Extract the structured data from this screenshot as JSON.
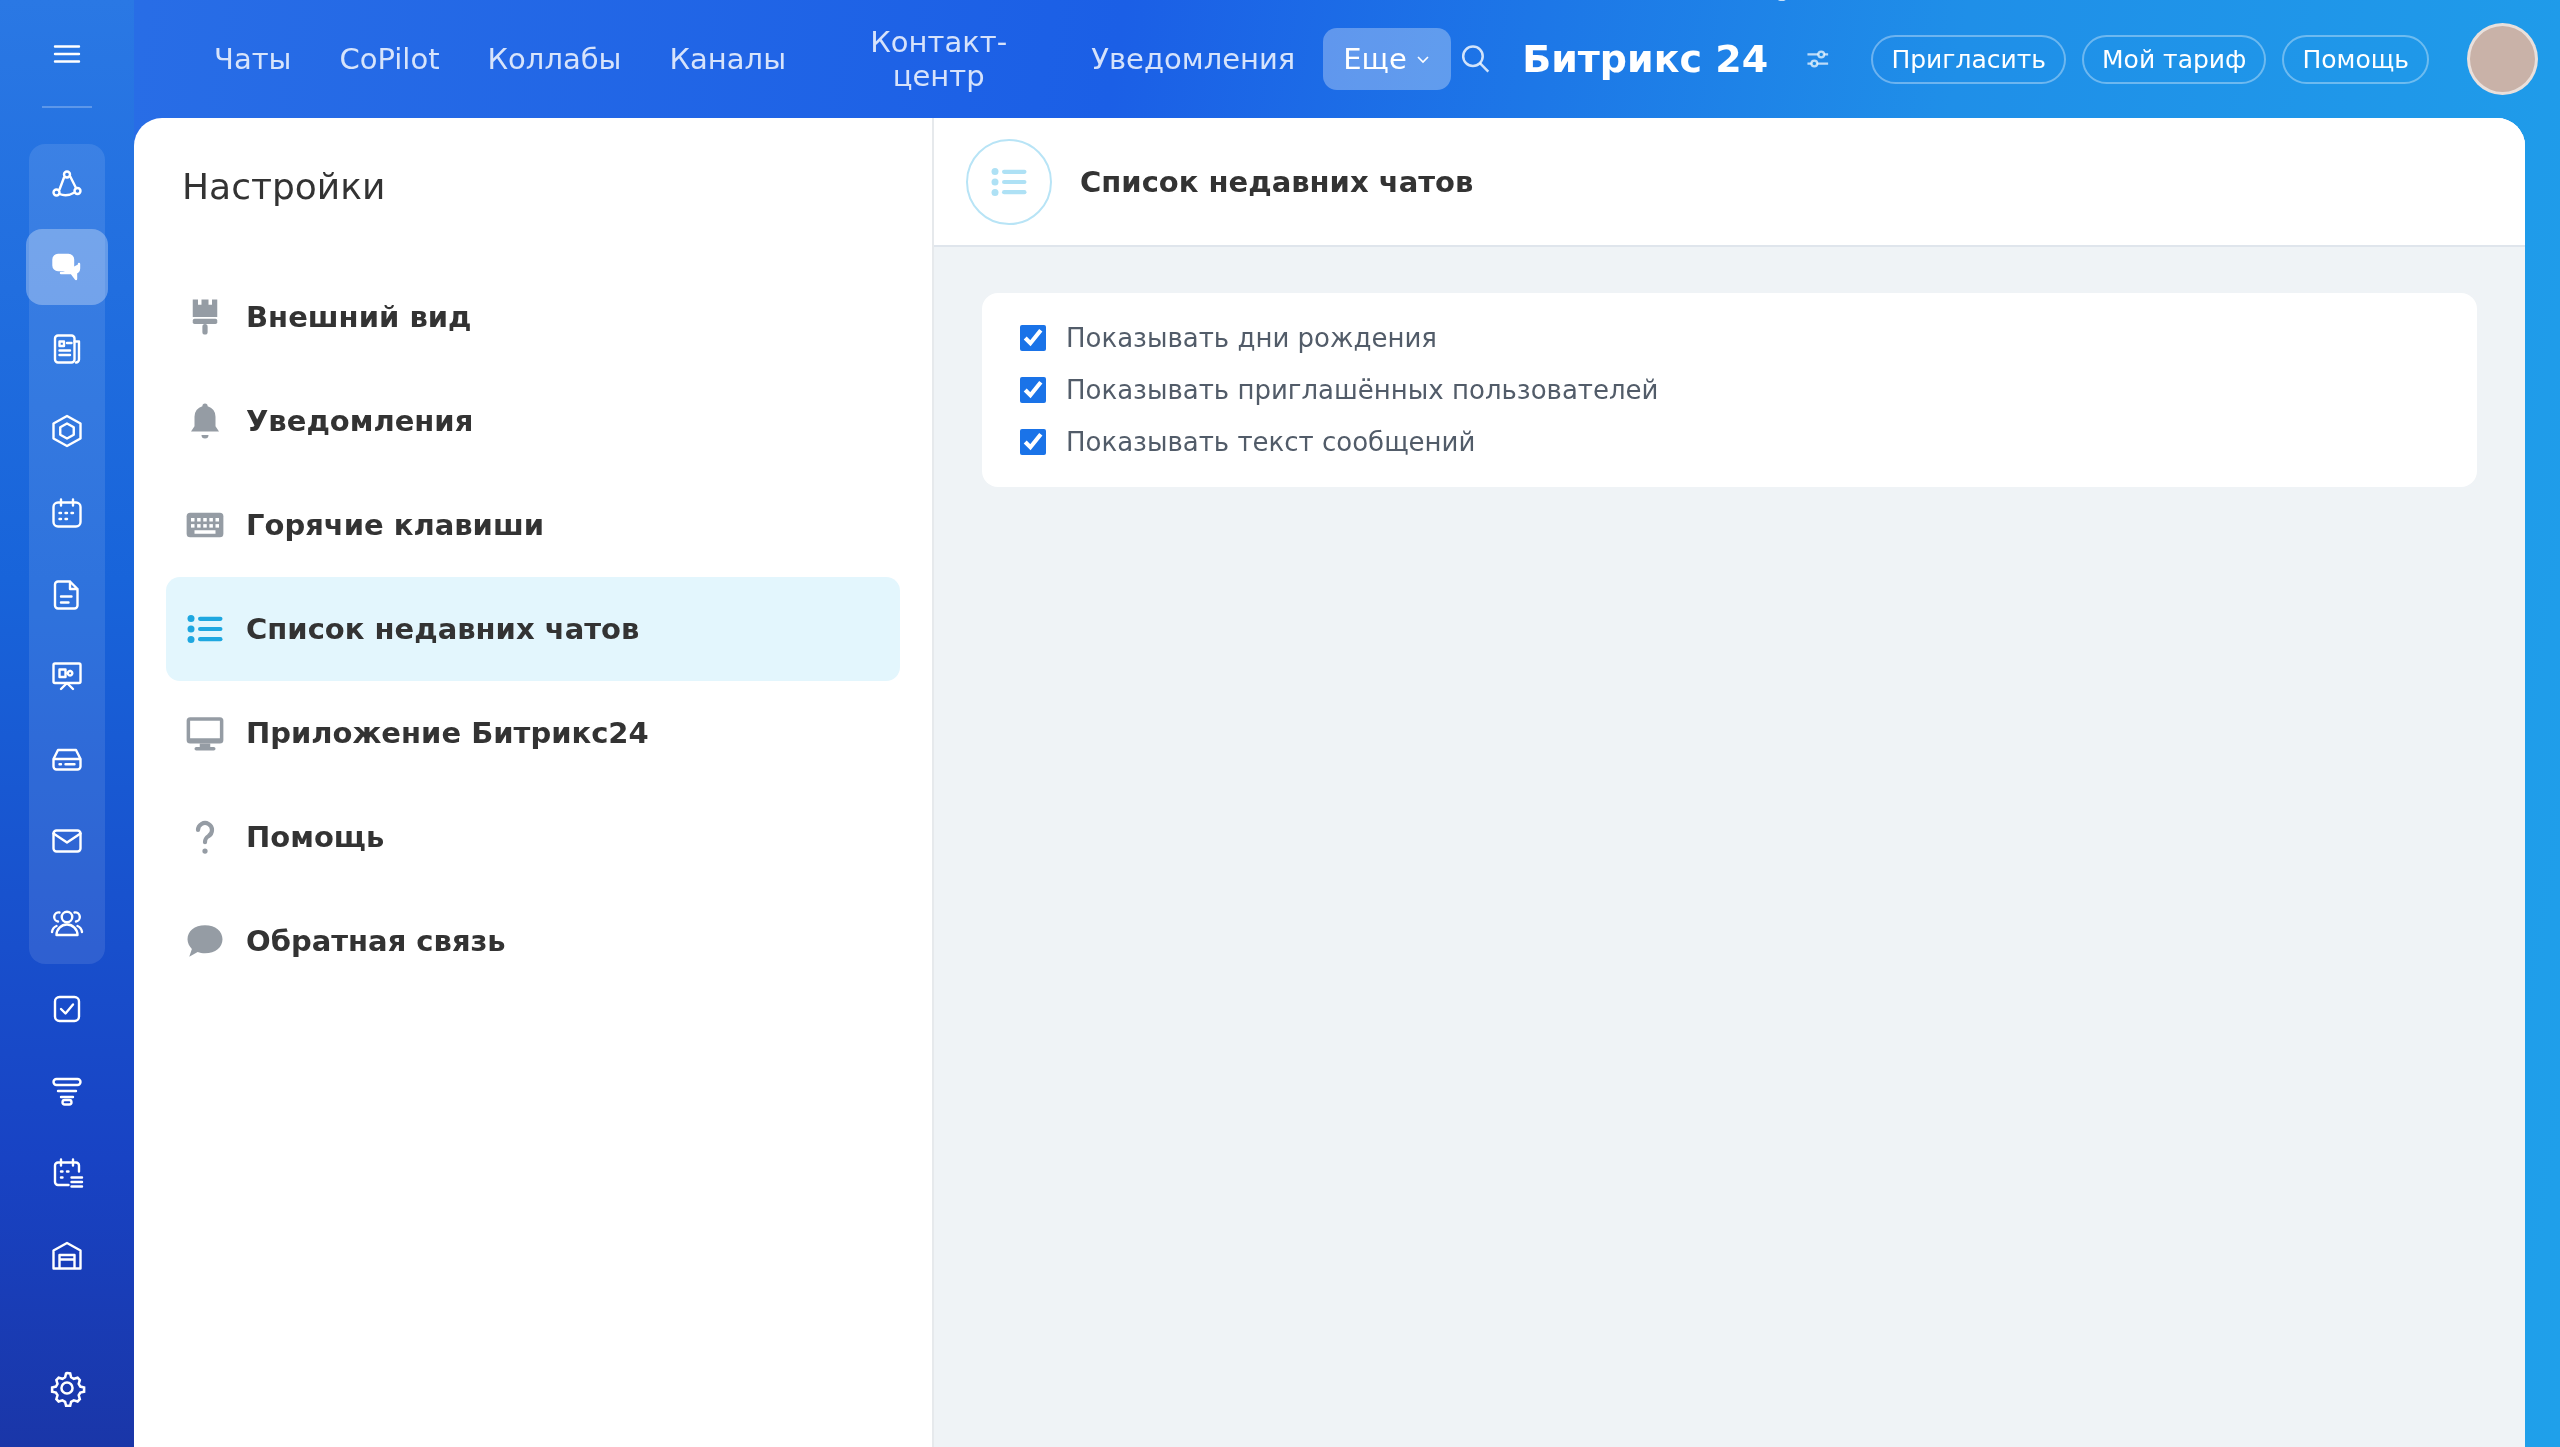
{
  "rail": {
    "pinned": [
      {
        "selected": false
      },
      {
        "selected": true
      },
      {
        "selected": false
      },
      {
        "selected": false
      },
      {
        "selected": false
      },
      {
        "selected": false
      },
      {
        "selected": false
      },
      {
        "selected": false
      },
      {
        "selected": false
      },
      {
        "selected": false
      }
    ],
    "others": [
      {
        "selected": false
      },
      {
        "selected": false
      },
      {
        "selected": false
      },
      {
        "selected": false
      }
    ]
  },
  "top_nav": {
    "items": [
      {
        "label": "Чаты",
        "selected": false
      },
      {
        "label": "CoPilot",
        "selected": false
      },
      {
        "label": "Коллабы",
        "selected": false
      },
      {
        "label": "Каналы",
        "selected": false
      },
      {
        "label": "Контакт-центр",
        "selected": false
      },
      {
        "label": "Уведомления",
        "selected": false
      },
      {
        "label": "Еще",
        "selected": true
      }
    ]
  },
  "logo": "Битрикс 24",
  "header_buttons": [
    "Пригласить",
    "Мой тариф",
    "Помощь"
  ],
  "settings": {
    "title": "Настройки",
    "items": [
      {
        "label": "Внешний вид",
        "selected": false
      },
      {
        "label": "Уведомления",
        "selected": false
      },
      {
        "label": "Горячие клавиши",
        "selected": false
      },
      {
        "label": "Список недавних чатов",
        "selected": true
      },
      {
        "label": "Приложение Битрикс24",
        "selected": false
      },
      {
        "label": "Помощь",
        "selected": false
      },
      {
        "label": "Обратная связь",
        "selected": false
      }
    ]
  },
  "content": {
    "title": "Список недавних чатов",
    "options": [
      {
        "label": "Показывать дни рождения",
        "checked": true
      },
      {
        "label": "Показывать приглашённых пользователей",
        "checked": true
      },
      {
        "label": "Показывать текст сообщений",
        "checked": true
      }
    ]
  }
}
